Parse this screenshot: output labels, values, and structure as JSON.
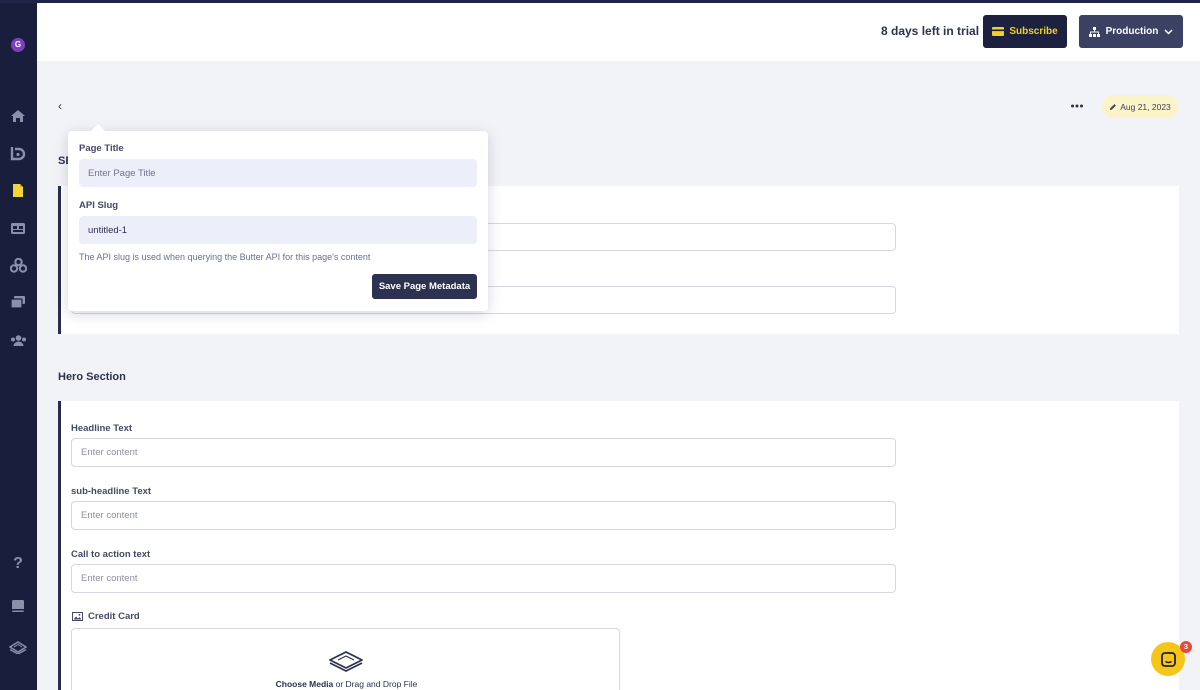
{
  "sidebar": {
    "avatar_initial": "G",
    "items": [
      {
        "icon": "home-icon"
      },
      {
        "icon": "blog-icon"
      },
      {
        "icon": "pages-icon"
      },
      {
        "icon": "collections-icon"
      },
      {
        "icon": "components-icon"
      },
      {
        "icon": "media-icon"
      },
      {
        "icon": "users-icon"
      }
    ],
    "bottom_items": [
      {
        "icon": "help-icon"
      },
      {
        "icon": "docs-icon"
      },
      {
        "icon": "butter-logo-icon"
      }
    ]
  },
  "header": {
    "trial_text": "8 days left in trial",
    "subscribe_label": "Subscribe",
    "environment_label": "Production"
  },
  "toolbar": {
    "date_label": "Aug 21, 2023"
  },
  "metadata_popover": {
    "page_title_label": "Page Title",
    "page_title_placeholder": "Enter Page Title",
    "api_slug_label": "API Slug",
    "api_slug_value": "untitled-1",
    "help_text": "The API slug is used when querying the Butter API for this page's content",
    "save_label": "Save Page Metadata"
  },
  "seo_section": {
    "title_fragment": "SE"
  },
  "hero_section": {
    "title": "Hero Section",
    "fields": [
      {
        "label": "Headline Text",
        "placeholder": "Enter content"
      },
      {
        "label": "sub-headline Text",
        "placeholder": "Enter content"
      },
      {
        "label": "Call to action text",
        "placeholder": "Enter content"
      }
    ],
    "media_field": {
      "label": "Credit Card",
      "choose_label": "Choose Media",
      "drop_label": " or Drag and Drop File"
    }
  },
  "chat": {
    "badge_count": "3"
  },
  "colors": {
    "sidebar": "#181e3c",
    "subscribe_bg": "#1c2140",
    "subscribe_text": "#f2d024",
    "production_bg": "#3a4163",
    "date_badge_bg": "#fcf3c8",
    "chat_bg": "#f5c518"
  }
}
